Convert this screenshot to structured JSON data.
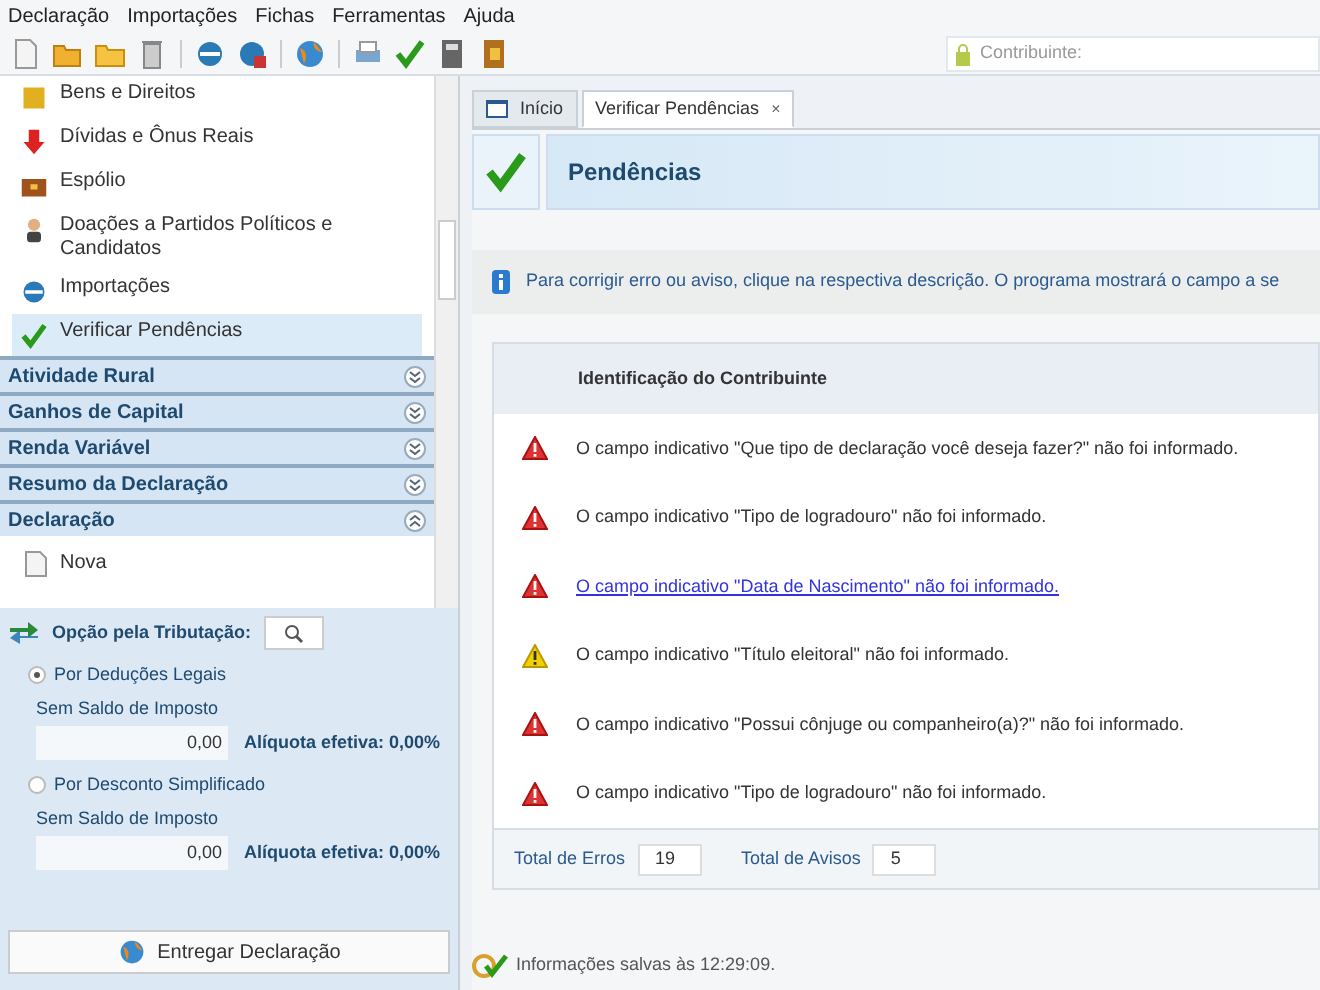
{
  "menu": [
    "Declaração",
    "Importações",
    "Fichas",
    "Ferramentas",
    "Ajuda"
  ],
  "contribuinte": {
    "label": "Contribuinte:"
  },
  "tree": [
    {
      "label": "Bens e Direitos",
      "selected": false
    },
    {
      "label": "Dívidas e Ônus Reais",
      "selected": false
    },
    {
      "label": "Espólio",
      "selected": false
    },
    {
      "label": "Doações a Partidos Políticos e Candidatos",
      "selected": false
    },
    {
      "label": "Importações",
      "selected": false
    },
    {
      "label": "Verificar Pendências",
      "selected": true
    }
  ],
  "sections": [
    {
      "label": "Atividade Rural",
      "expanded": false
    },
    {
      "label": "Ganhos de Capital",
      "expanded": false
    },
    {
      "label": "Renda Variável",
      "expanded": false
    },
    {
      "label": "Resumo da Declaração",
      "expanded": false
    },
    {
      "label": "Declaração",
      "expanded": true
    }
  ],
  "section_items": [
    "Nova"
  ],
  "tributacao": {
    "title": "Opção pela Tributação:",
    "options": [
      {
        "label": "Por Deduções Legais",
        "selected": true,
        "sublabel": "Sem Saldo de Imposto",
        "value": "0,00",
        "rate": "Alíquota efetiva: 0,00%"
      },
      {
        "label": "Por Desconto Simplificado",
        "selected": false,
        "sublabel": "Sem Saldo de Imposto",
        "value": "0,00",
        "rate": "Alíquota efetiva: 0,00%"
      }
    ]
  },
  "submit_button": "Entregar Declaração",
  "tabs": [
    {
      "label": "Início",
      "selected": false,
      "closable": false
    },
    {
      "label": "Verificar Pendências",
      "selected": true,
      "closable": true
    }
  ],
  "close_glyph": "×",
  "header": {
    "title": "Pendências"
  },
  "info": "Para corrigir erro ou aviso, clique na respectiva descrição. O programa mostrará o campo a se",
  "group_title": "Identificação do Contribuinte",
  "messages": [
    {
      "kind": "error",
      "text": "O campo indicativo \"Que tipo de declaração você deseja fazer?\" não foi informado.",
      "link": false
    },
    {
      "kind": "error",
      "text": "O campo indicativo \"Tipo de logradouro\" não foi informado.",
      "link": false
    },
    {
      "kind": "error",
      "text": "O campo indicativo \"Data de Nascimento\" não foi informado.",
      "link": true
    },
    {
      "kind": "warning",
      "text": "O campo indicativo \"Título eleitoral\" não foi informado.",
      "link": false
    },
    {
      "kind": "error",
      "text": "O campo indicativo \"Possui cônjuge ou companheiro(a)?\" não foi informado.",
      "link": false
    },
    {
      "kind": "error",
      "text": "O campo indicativo \"Tipo de logradouro\" não foi informado.",
      "link": false
    }
  ],
  "totals": [
    {
      "label": "Total de Erros",
      "value": "19"
    },
    {
      "label": "Total de Avisos",
      "value": "5"
    }
  ],
  "status": "Informações salvas às 12:29:09."
}
